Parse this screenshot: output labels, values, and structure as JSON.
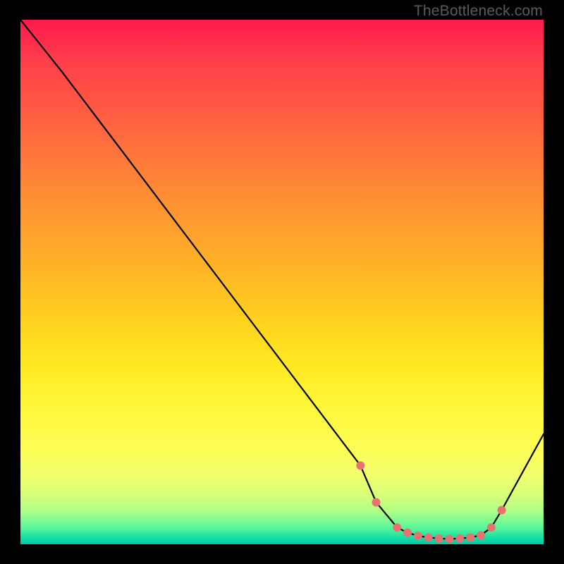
{
  "attribution": "TheBottleneck.com",
  "colors": {
    "line": "#000000",
    "marker": "#e8726f",
    "background_top": "#ff1a4b",
    "background_bottom": "#00c8a8"
  },
  "chart_data": {
    "type": "line",
    "title": "",
    "xlabel": "",
    "ylabel": "",
    "xlim": [
      0,
      100
    ],
    "ylim": [
      0,
      100
    ],
    "series": [
      {
        "name": "bottleneck-curve",
        "x": [
          0,
          8,
          65,
          68,
          72,
          74,
          76,
          78,
          80,
          82,
          84,
          86,
          88,
          90,
          92,
          100
        ],
        "y": [
          100,
          90,
          15,
          8,
          3.2,
          2.2,
          1.6,
          1.3,
          1.1,
          1.0,
          1.1,
          1.3,
          1.7,
          3.2,
          6.5,
          21
        ]
      }
    ],
    "markers": {
      "name": "highlighted-points",
      "x": [
        65,
        68,
        72,
        74,
        76,
        78,
        80,
        82,
        84,
        86,
        88,
        90,
        92
      ],
      "y": [
        15,
        8,
        3.2,
        2.2,
        1.6,
        1.3,
        1.1,
        1.0,
        1.1,
        1.3,
        1.7,
        3.2,
        6.5
      ]
    }
  }
}
